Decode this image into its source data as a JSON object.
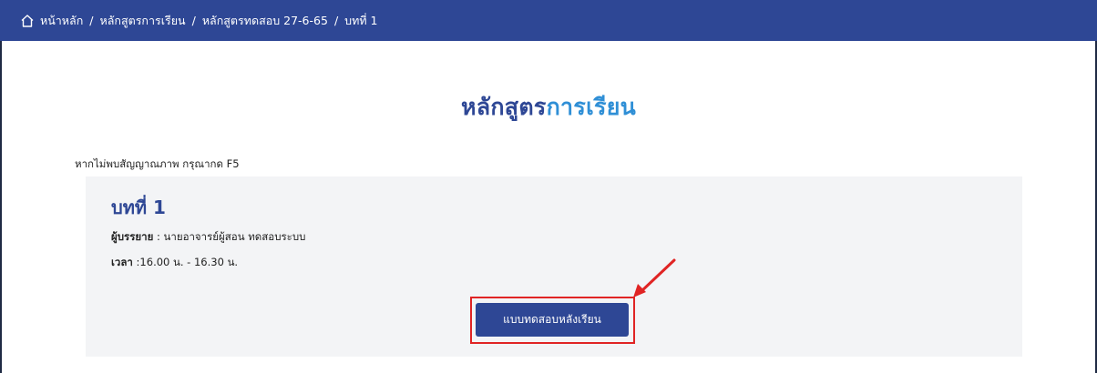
{
  "breadcrumb": {
    "items": [
      "หน้าหลัก",
      "หลักสูตรการเรียน",
      "หลักสูตรทดสอบ 27-6-65",
      "บทที่ 1"
    ],
    "separator": "/"
  },
  "page_title": {
    "part1": "หลักสูตร",
    "part2": "การเรียน"
  },
  "notice": "หากไม่พบสัญญาณภาพ กรุณากด F5",
  "lesson": {
    "title": "บทที่ 1",
    "lecturer_label": "ผู้บรรยาย",
    "lecturer_value": " : นายอาจารย์ผู้สอน ทดสอบระบบ",
    "time_label": "เวลา",
    "time_value": " :16.00 น. - 16.30 น."
  },
  "quiz_button_label": "แบบทดสอบหลังเรียน",
  "colors": {
    "navbar": "#2e4795",
    "title_primary": "#2e4795",
    "title_accent": "#2f8fd6",
    "panel_bg": "#f3f4f6",
    "highlight": "#e02424"
  },
  "icons": {
    "home": "home-icon",
    "arrow": "annotation-arrow-icon"
  }
}
